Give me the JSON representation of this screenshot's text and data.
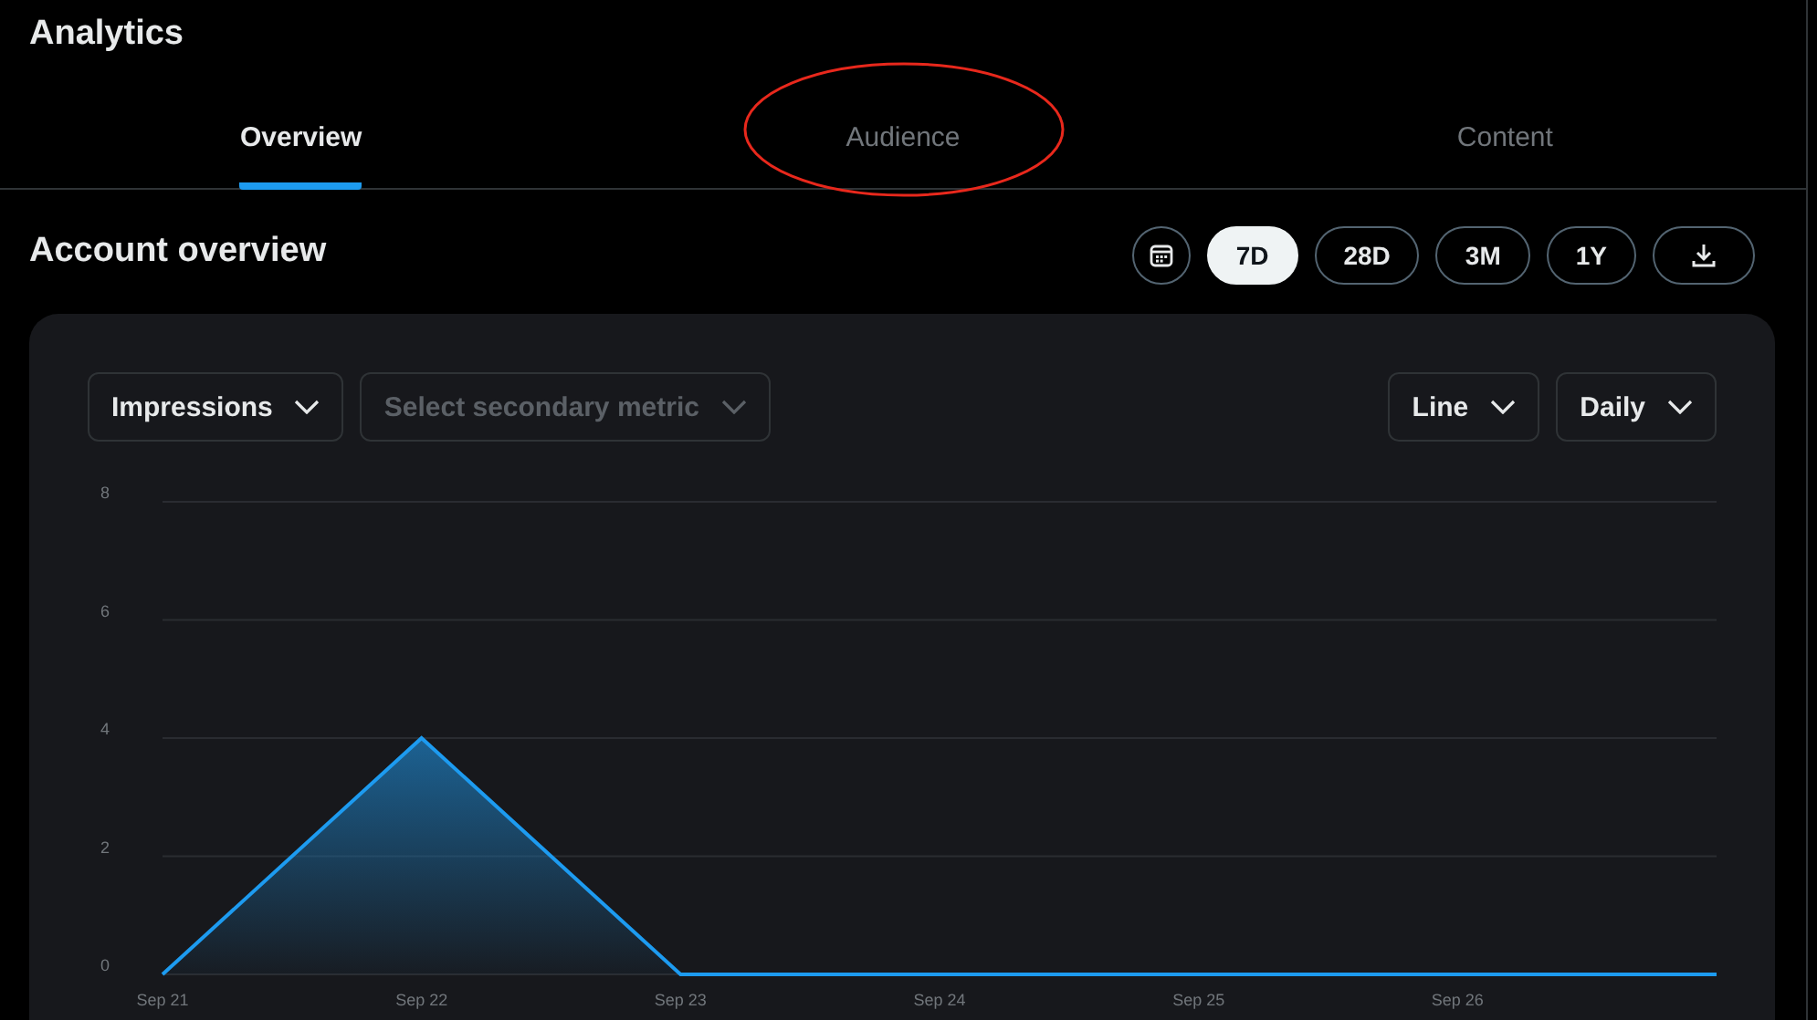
{
  "page": {
    "title": "Analytics"
  },
  "tabs": [
    {
      "label": "Overview",
      "selected": true,
      "circled": false
    },
    {
      "label": "Audience",
      "selected": false,
      "circled": true
    },
    {
      "label": "Content",
      "selected": false,
      "circled": false
    }
  ],
  "section": {
    "title": "Account overview"
  },
  "range_buttons": [
    {
      "label": "7D",
      "selected": true
    },
    {
      "label": "28D",
      "selected": false
    },
    {
      "label": "3M",
      "selected": false
    },
    {
      "label": "1Y",
      "selected": false
    }
  ],
  "controls": {
    "primary_metric": "Impressions",
    "secondary_metric": {
      "placeholder": "Select secondary metric"
    },
    "chart_type": "Line",
    "interval": "Daily"
  },
  "chart_data": {
    "type": "area",
    "categories": [
      "Sep 21",
      "Sep 22",
      "Sep 23",
      "Sep 24",
      "Sep 25",
      "Sep 26",
      null
    ],
    "series": [
      {
        "color": "#1d9bf0",
        "values": [
          0,
          4,
          0,
          0,
          0,
          0,
          0
        ]
      }
    ],
    "ylim": [
      0,
      8
    ],
    "yticks": [
      0,
      2,
      4,
      6,
      8
    ],
    "grid": true
  }
}
